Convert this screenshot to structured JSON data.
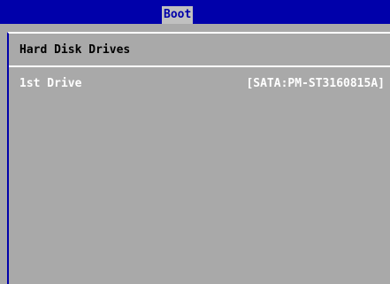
{
  "menubar": {
    "active_tab": "Boot"
  },
  "panel": {
    "title": "Hard Disk Drives",
    "options": [
      {
        "label": "1st Drive",
        "value": "[SATA:PM-ST3160815A]"
      }
    ]
  },
  "colors": {
    "menubar_bg": "#0000aa",
    "tab_bg": "#c0c0c0",
    "panel_bg": "#a9a9a9",
    "option_text": "#ffffff",
    "title_text": "#000000"
  }
}
